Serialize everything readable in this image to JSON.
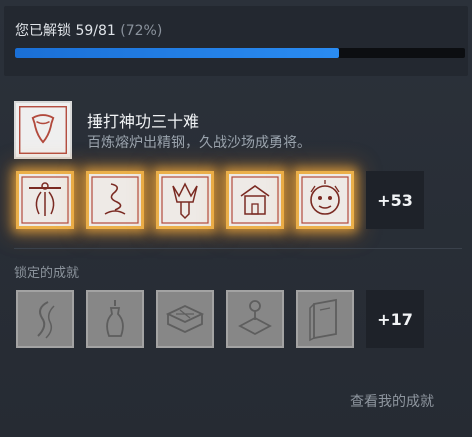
{
  "progress": {
    "label": "您已解锁 59/81",
    "percent_text": "(72%)",
    "fraction": 0.72
  },
  "featured": {
    "title": "捶打神功三十难",
    "description": "百炼熔炉出精钢，久战沙场成勇将。",
    "icon": "armor-plaque-icon"
  },
  "unlocked": {
    "icons": [
      "sage-figure-icon",
      "smoke-swirl-icon",
      "tree-spirit-icon",
      "shrine-icon",
      "monkey-king-icon"
    ],
    "more_label": "+53"
  },
  "locked": {
    "title": "锁定的成就",
    "icons": [
      "wave-icon",
      "vase-icon",
      "brazier-icon",
      "altar-icon",
      "box-icon"
    ],
    "more_label": "+17"
  },
  "footer": {
    "view_link": "查看我的成就"
  },
  "colors": {
    "progress_fill": "#2a8cf2",
    "glow": "#ebb04a",
    "background": "#272d36"
  }
}
